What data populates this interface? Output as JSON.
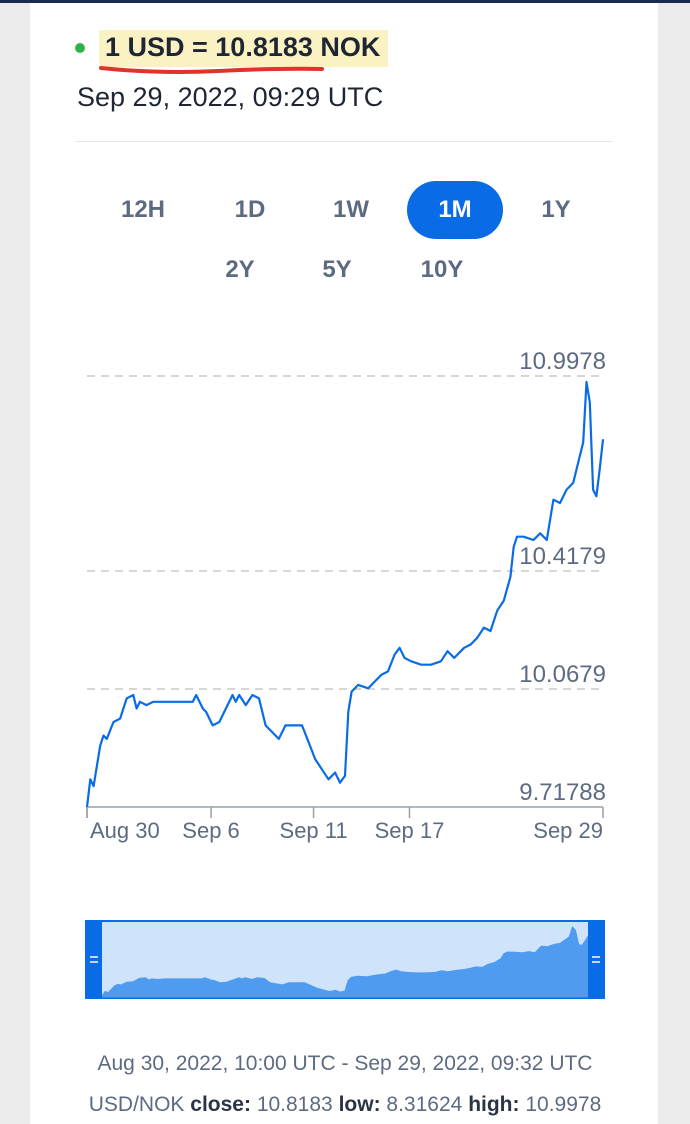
{
  "header": {
    "rate": "1 USD = 10.8183 NOK",
    "timestamp": "Sep 29, 2022, 09:29 UTC"
  },
  "ranges": [
    {
      "label": "12H",
      "active": false
    },
    {
      "label": "1D",
      "active": false
    },
    {
      "label": "1W",
      "active": false
    },
    {
      "label": "1M",
      "active": true
    },
    {
      "label": "1Y",
      "active": false
    },
    {
      "label": "2Y",
      "active": false
    },
    {
      "label": "5Y",
      "active": false
    },
    {
      "label": "10Y",
      "active": false
    }
  ],
  "colors": {
    "line": "#0a6be6",
    "active": "#0a6be6",
    "live_dot": "#2db34a",
    "highlight": "#fbf2c4",
    "underline": "#e0342b",
    "navigator_fill": "#4f9bf0",
    "navigator_bg": "#cfe3fb"
  },
  "chart_data": {
    "type": "line",
    "series": [
      {
        "values": [
          [
            0.0,
            9.718
          ],
          [
            0.2,
            9.8
          ],
          [
            0.4,
            9.78
          ],
          [
            0.8,
            9.9
          ],
          [
            1.0,
            9.93
          ],
          [
            1.2,
            9.92
          ],
          [
            1.6,
            9.97
          ],
          [
            2.0,
            9.98
          ],
          [
            2.4,
            10.04
          ],
          [
            2.8,
            10.05
          ],
          [
            3.0,
            10.01
          ],
          [
            3.2,
            10.03
          ],
          [
            3.6,
            10.02
          ],
          [
            4.0,
            10.03
          ],
          [
            4.6,
            10.03
          ],
          [
            5.0,
            10.03
          ],
          [
            5.6,
            10.03
          ],
          [
            6.0,
            10.03
          ],
          [
            6.4,
            10.03
          ],
          [
            6.6,
            10.05
          ],
          [
            7.0,
            10.01
          ],
          [
            7.2,
            10.0
          ],
          [
            7.6,
            9.96
          ],
          [
            8.0,
            9.97
          ],
          [
            8.4,
            10.01
          ],
          [
            8.8,
            10.05
          ],
          [
            9.0,
            10.03
          ],
          [
            9.2,
            10.05
          ],
          [
            9.6,
            10.02
          ],
          [
            10.0,
            10.05
          ],
          [
            10.4,
            10.04
          ],
          [
            10.8,
            9.96
          ],
          [
            11.2,
            9.94
          ],
          [
            11.6,
            9.92
          ],
          [
            12.0,
            9.96
          ],
          [
            12.6,
            9.96
          ],
          [
            13.0,
            9.96
          ],
          [
            13.4,
            9.91
          ],
          [
            13.8,
            9.86
          ],
          [
            14.2,
            9.83
          ],
          [
            14.6,
            9.8
          ],
          [
            15.0,
            9.82
          ],
          [
            15.3,
            9.79
          ],
          [
            15.6,
            9.81
          ],
          [
            15.8,
            10.0
          ],
          [
            16.0,
            10.06
          ],
          [
            16.4,
            10.08
          ],
          [
            17.0,
            10.07
          ],
          [
            17.4,
            10.09
          ],
          [
            17.8,
            10.11
          ],
          [
            18.2,
            10.12
          ],
          [
            18.6,
            10.17
          ],
          [
            18.9,
            10.19
          ],
          [
            19.2,
            10.16
          ],
          [
            19.6,
            10.15
          ],
          [
            20.2,
            10.14
          ],
          [
            20.8,
            10.14
          ],
          [
            21.4,
            10.15
          ],
          [
            21.8,
            10.18
          ],
          [
            22.2,
            10.16
          ],
          [
            22.8,
            10.19
          ],
          [
            23.2,
            10.2
          ],
          [
            23.6,
            10.22
          ],
          [
            24.0,
            10.25
          ],
          [
            24.4,
            10.24
          ],
          [
            24.8,
            10.3
          ],
          [
            25.2,
            10.33
          ],
          [
            25.6,
            10.4
          ],
          [
            25.8,
            10.49
          ],
          [
            26.0,
            10.52
          ],
          [
            26.4,
            10.52
          ],
          [
            27.0,
            10.51
          ],
          [
            27.4,
            10.53
          ],
          [
            27.8,
            10.51
          ],
          [
            28.0,
            10.57
          ],
          [
            28.2,
            10.63
          ],
          [
            28.6,
            10.62
          ],
          [
            29.0,
            10.66
          ],
          [
            29.4,
            10.68
          ],
          [
            29.8,
            10.76
          ],
          [
            30.0,
            10.8
          ],
          [
            30.2,
            10.98
          ],
          [
            30.4,
            10.92
          ],
          [
            30.6,
            10.66
          ],
          [
            30.8,
            10.64
          ],
          [
            31.0,
            10.72
          ],
          [
            31.2,
            10.81
          ]
        ]
      }
    ],
    "yticks": [
      "10.9978",
      "10.4179",
      "10.0679",
      "9.71788"
    ],
    "ytick_values": [
      10.9978,
      10.4179,
      10.0679,
      9.71788
    ],
    "xticks": [
      "Aug 30",
      "Sep 6",
      "Sep 11",
      "Sep 17",
      "Sep 29"
    ],
    "xtick_values": [
      0,
      7.5,
      13.7,
      19.5,
      31.2
    ],
    "ylim": [
      9.71788,
      10.9978
    ],
    "xlim": [
      0,
      31.2
    ],
    "grid": true,
    "navigator": {
      "range_start": 0,
      "range_end": 31.2
    }
  },
  "footer": {
    "range_text": "Aug 30, 2022, 10:00 UTC - Sep 29, 2022, 09:32 UTC",
    "pair": "USD/NOK",
    "close_label": "close:",
    "close_value": "10.8183",
    "low_label": "low:",
    "low_value": "8.31624",
    "high_label": "high:",
    "high_value": "10.9978"
  }
}
